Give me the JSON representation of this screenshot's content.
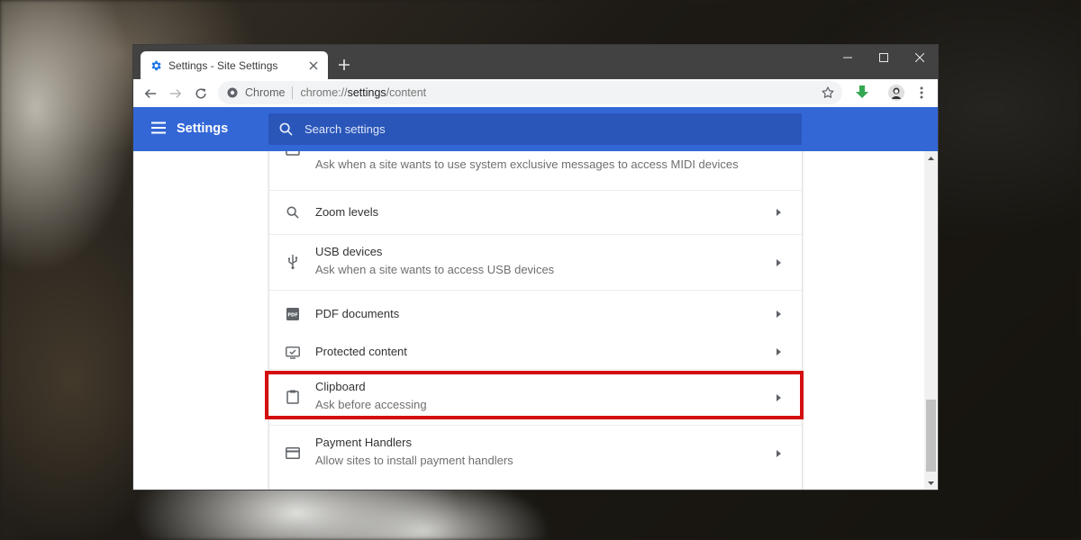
{
  "tab": {
    "title": "Settings - Site Settings"
  },
  "toolbar": {
    "site_chip": "Chrome",
    "url_scheme": "chrome://",
    "url_host": "settings",
    "url_path": "/content"
  },
  "header": {
    "title": "Settings",
    "search_placeholder": "Search settings"
  },
  "rows": [
    {
      "icon": "midi-icon",
      "title": "",
      "subtitle": "Ask when a site wants to use system exclusive messages to access MIDI devices"
    },
    {
      "icon": "search-icon",
      "title": "Zoom levels",
      "subtitle": ""
    },
    {
      "icon": "usb-icon",
      "title": "USB devices",
      "subtitle": "Ask when a site wants to access USB devices"
    },
    {
      "icon": "pdf-icon",
      "title": "PDF documents",
      "subtitle": ""
    },
    {
      "icon": "protected-content-icon",
      "title": "Protected content",
      "subtitle": ""
    },
    {
      "icon": "clipboard-icon",
      "title": "Clipboard",
      "subtitle": "Ask before accessing"
    },
    {
      "icon": "payment-card-icon",
      "title": "Payment Handlers",
      "subtitle": "Allow sites to install payment handlers"
    }
  ],
  "pdf_icon_text": "PDF",
  "colors": {
    "header_blue": "#3367d6",
    "search_box": "#2a56b9",
    "highlight_red": "#d40f0f",
    "tabstrip": "#424242",
    "download_green": "#1e8e3e"
  }
}
